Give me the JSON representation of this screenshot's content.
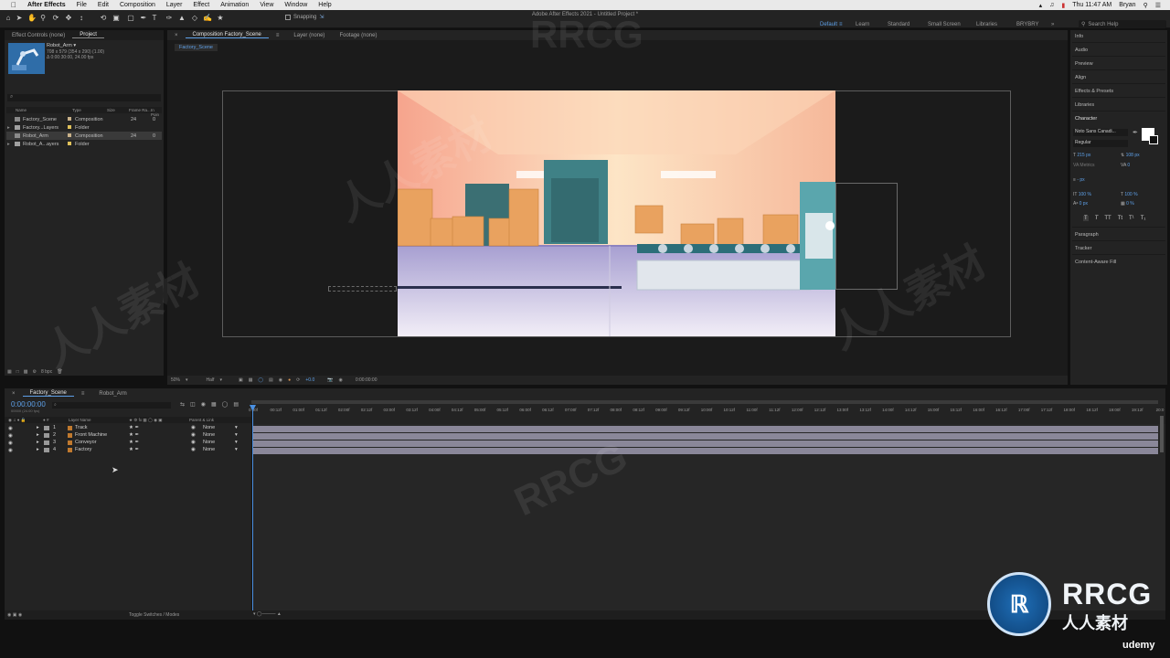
{
  "menubar": {
    "app_name": "After Effects",
    "items": [
      "File",
      "Edit",
      "Composition",
      "Layer",
      "Effect",
      "Animation",
      "View",
      "Window",
      "Help"
    ],
    "clock": "Thu 11:47 AM",
    "user": "Bryan"
  },
  "window": {
    "title": "Adobe After Effects 2021 - Untitled Project *"
  },
  "toolbar": {
    "snapping_label": "Snapping"
  },
  "workspaces": [
    {
      "label": "Default",
      "active": true
    },
    {
      "label": "Learn"
    },
    {
      "label": "Standard"
    },
    {
      "label": "Small Screen"
    },
    {
      "label": "Libraries"
    },
    {
      "label": "BRYBRY"
    }
  ],
  "search_help": {
    "placeholder": "Search Help"
  },
  "left_panel": {
    "tabs": [
      "Effect Controls (none)",
      "Project"
    ],
    "preview": {
      "name": "Robot_Arm ▾",
      "info1": "708 x 579 (354 x 290) (1.00)",
      "info2": "Δ 0:00:30:00, 24.00 fps"
    },
    "search_placeholder": "⌕",
    "columns": {
      "name": "Name",
      "type": "Type",
      "size": "Size",
      "rate": "Frame Ra...",
      "in_point": "In Poin"
    },
    "rows": [
      {
        "name": "Factory_Scene",
        "type": "Composition",
        "rate": "24",
        "extra": "0",
        "color": "#c9b28a",
        "selected": false
      },
      {
        "name": "Factory...Layers",
        "type": "Folder",
        "rate": "",
        "extra": "",
        "color": "#e0c25a",
        "selected": false
      },
      {
        "name": "Robot_Arm",
        "type": "Composition",
        "rate": "24",
        "extra": "0",
        "color": "#c9b28a",
        "selected": true
      },
      {
        "name": "Robot_A...ayers",
        "type": "Folder",
        "rate": "",
        "extra": "",
        "color": "#e0c25a",
        "selected": false
      }
    ],
    "bpc": "8 bpc"
  },
  "comp_panel": {
    "tabs": [
      "Composition Factory_Scene",
      "Layer (none)",
      "Footage (none)"
    ],
    "breadcrumb": "Factory_Scene",
    "footer": {
      "zoom": "50%",
      "resolution": "Half",
      "exposure": "+0.0",
      "timecode": "0:00:00:00"
    }
  },
  "right_panel": {
    "items": [
      "Info",
      "Audio",
      "Preview",
      "Align",
      "Effects & Presets",
      "Libraries"
    ],
    "character": {
      "title": "Character",
      "font": "Noto Sans Canadi...",
      "style": "Regular",
      "size": "215 px",
      "leading": "108 px",
      "kerning": "Metrics",
      "tracking": "0",
      "stroke_unit": "- px",
      "vscale": "100 %",
      "hscale": "100 %",
      "baseline": "0 px",
      "tsume": "0 %",
      "styles": [
        "T",
        "T",
        "TT",
        "Tt",
        "T¹",
        "T₁"
      ]
    },
    "bottom_items": [
      "Paragraph",
      "Tracker",
      "Content-Aware Fill"
    ]
  },
  "timeline": {
    "tabs": [
      "Factory_Scene",
      "Robot_Arm"
    ],
    "timecode": "0:00:00:00",
    "fps_info": "00000 (24.00 fps)",
    "search_placeholder": "⌕",
    "col_layer_name": "Layer Name",
    "col_parent": "Parent & Link",
    "ruler": [
      "0:00f",
      "00:12f",
      "01:00f",
      "01:12f",
      "02:00f",
      "02:12f",
      "03:00f",
      "03:12f",
      "04:00f",
      "04:12f",
      "05:00f",
      "05:12f",
      "06:00f",
      "06:12f",
      "07:00f",
      "07:12f",
      "08:00f",
      "08:12f",
      "09:00f",
      "09:12f",
      "10:00f",
      "10:12f",
      "11:00f",
      "11:12f",
      "12:00f",
      "12:12f",
      "13:00f",
      "13:12f",
      "14:00f",
      "14:12f",
      "15:00f",
      "15:12f",
      "16:00f",
      "16:12f",
      "17:00f",
      "17:12f",
      "18:00f",
      "18:12f",
      "19:00f",
      "19:12f",
      "20:0"
    ],
    "layers": [
      {
        "num": "1",
        "name": "Track",
        "parent": "None"
      },
      {
        "num": "2",
        "name": "Front Machine",
        "parent": "None"
      },
      {
        "num": "3",
        "name": "Conveyor",
        "parent": "None"
      },
      {
        "num": "4",
        "name": "Factory",
        "parent": "None"
      }
    ],
    "footer_label": "Toggle Switches / Modes"
  },
  "watermark": {
    "text1": "RRCG",
    "text2": "人人素材",
    "brand": "udemy"
  }
}
